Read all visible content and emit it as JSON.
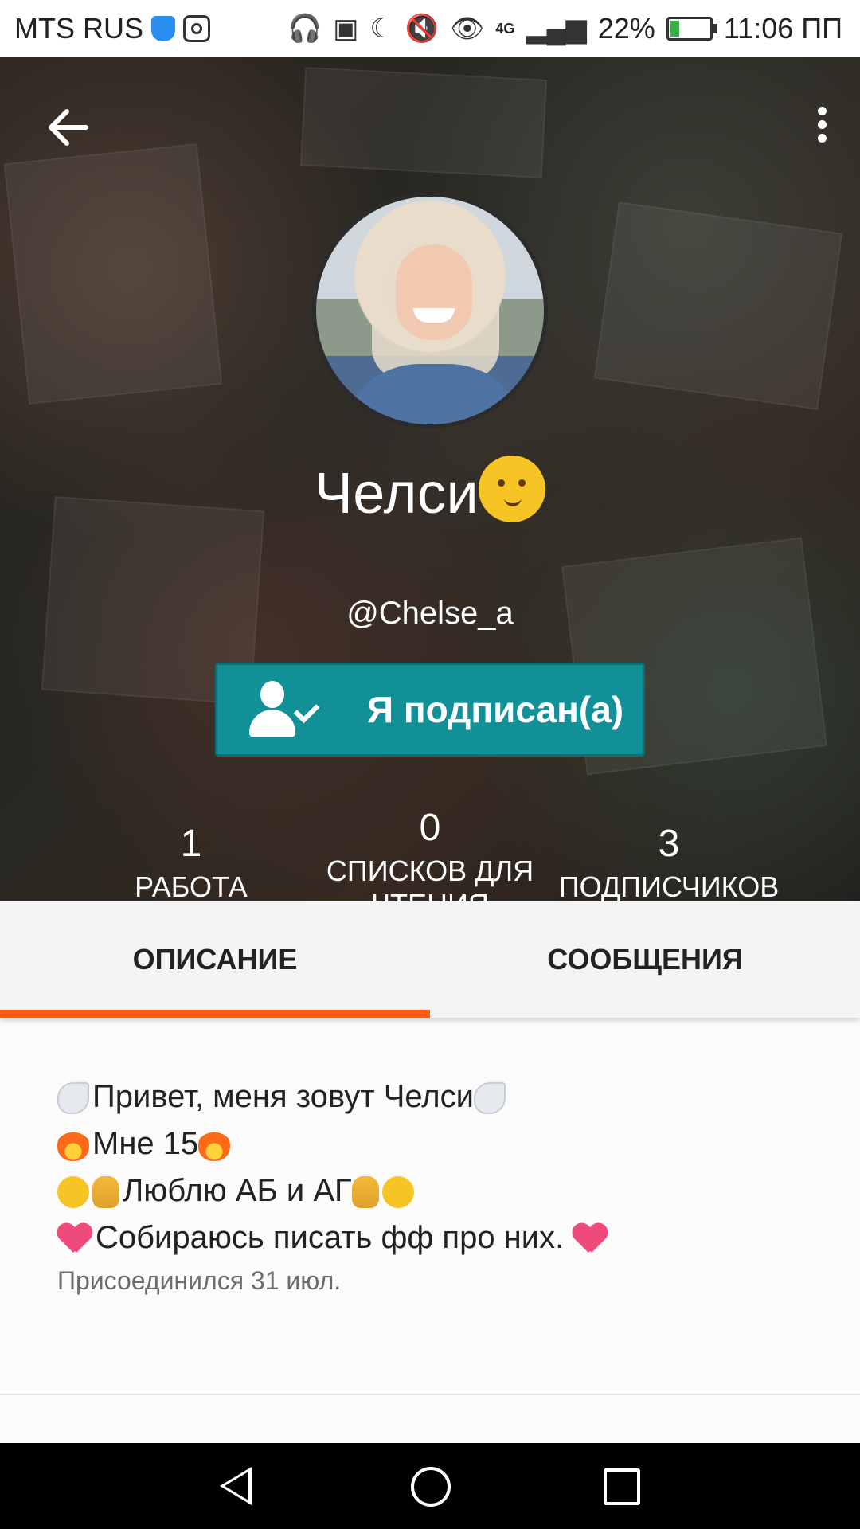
{
  "status_bar": {
    "carrier": "MTS RUS",
    "network": "4G",
    "battery": "22%",
    "battery_level": 0.22,
    "time": "11:06 ПП",
    "icons": [
      "shield-icon",
      "instagram-icon",
      "headphones-icon",
      "nfc-icon",
      "moon-icon",
      "mute-icon",
      "eye-icon",
      "signal-icon",
      "battery-icon"
    ]
  },
  "header": {
    "display_name": "Челси",
    "username": "@Chelse_a",
    "follow_button_label": "Я подписан(а)"
  },
  "stats": [
    {
      "value": "1",
      "label": "РАБОТА"
    },
    {
      "value": "0",
      "label": "СПИСКОВ ДЛЯ ЧТЕНИЯ"
    },
    {
      "value": "3",
      "label": "ПОДПИСЧИКОВ"
    }
  ],
  "tabs": [
    {
      "label": "ОПИСАНИЕ",
      "active": true
    },
    {
      "label": "СООБЩЕНИЯ",
      "active": false
    }
  ],
  "description": {
    "lines": [
      "Привет, меня зовут Челси",
      "Мне 15",
      "Люблю АБ и АГ",
      "Собираюсь писать фф про них."
    ],
    "joined": "Присоединился 31 июл."
  },
  "colors": {
    "accent": "#129097",
    "tab_indicator": "#ff5a12"
  }
}
